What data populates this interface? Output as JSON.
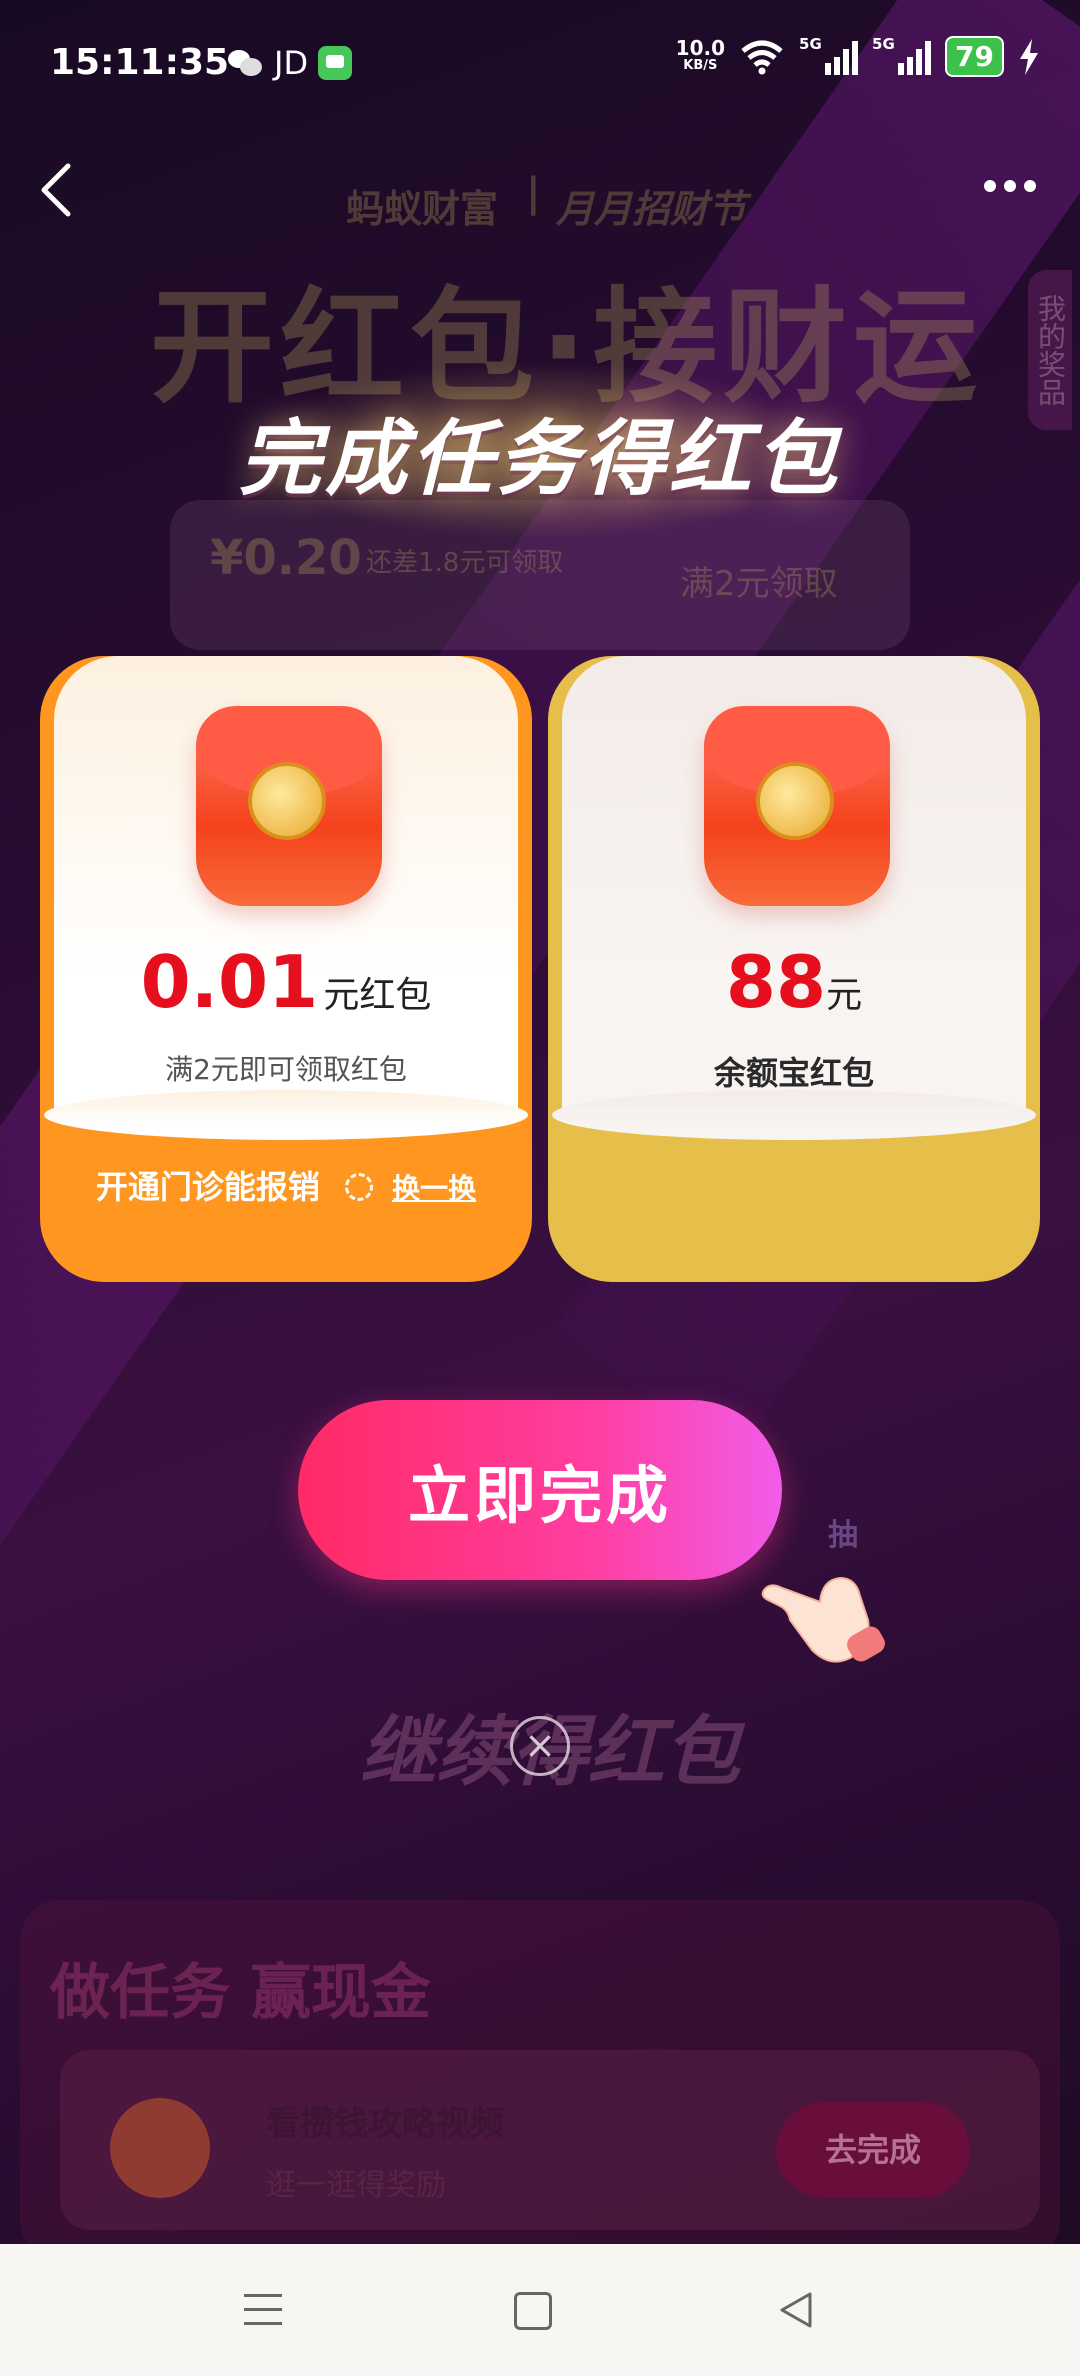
{
  "status_bar": {
    "time": "15:11:35",
    "app_label": "JD",
    "net_speed": "10.0",
    "net_unit": "KB/S",
    "signal1": "5G",
    "signal2": "5G",
    "battery": "79"
  },
  "nav": {
    "back_icon": "chevron-left-icon",
    "more_icon": "more-dots-icon"
  },
  "background": {
    "brand": "蚂蚁财富",
    "festival": "月月招财节",
    "banner": "开红包·接财运",
    "side_tab": "我的奖品",
    "progress_amount": "¥0.20",
    "progress_hint": "还差1.8元可领取",
    "progress_button": "满2元领取",
    "continue_text": "继续得红包",
    "draw_label": "抽"
  },
  "modal": {
    "headline": "完成任务得红包",
    "cards": [
      {
        "amount": "0.01",
        "unit": "元红包",
        "subtitle": "满2元即可领取红包",
        "footer": "开通门诊能报销",
        "swap_label": "换一换"
      },
      {
        "amount": "88",
        "unit": "元",
        "subtitle": "余额宝红包"
      }
    ],
    "cta_label": "立即完成",
    "close_icon": "close-icon"
  },
  "tasks": {
    "title": "做任务 赢现金",
    "items": [
      {
        "name": "看攒钱攻略视频",
        "desc": "逛一逛得奖励",
        "button": "去完成"
      }
    ]
  },
  "colors": {
    "accent": "#ff2a66",
    "amount_red": "#e60f1e",
    "card_orange": "#ff9620",
    "card_gold": "#e5bf4a"
  }
}
